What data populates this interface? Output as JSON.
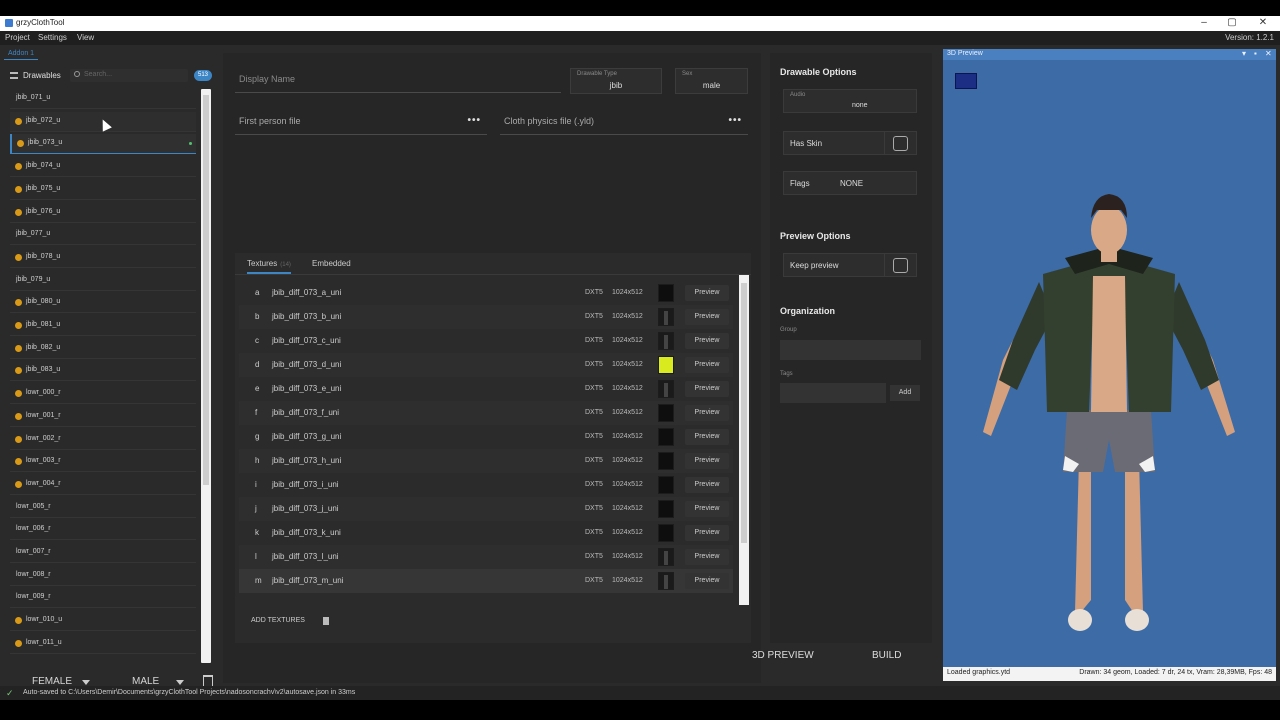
{
  "window": {
    "title": "grzyClothTool"
  },
  "menu": {
    "items": [
      "Project",
      "Settings",
      "View"
    ],
    "version": "Version: 1.2.1"
  },
  "addon_tab": "Addon 1",
  "left": {
    "header": "Drawables",
    "search_placeholder": "Search...",
    "count": "513",
    "items": [
      {
        "label": "jbib_071_u",
        "dot": false
      },
      {
        "label": "jbib_072_u",
        "dot": true
      },
      {
        "label": "jbib_073_u",
        "dot": true
      },
      {
        "label": "jbib_074_u",
        "dot": true
      },
      {
        "label": "jbib_075_u",
        "dot": true
      },
      {
        "label": "jbib_076_u",
        "dot": true
      },
      {
        "label": "jbib_077_u",
        "dot": false
      },
      {
        "label": "jbib_078_u",
        "dot": true
      },
      {
        "label": "jbib_079_u",
        "dot": false
      },
      {
        "label": "jbib_080_u",
        "dot": true
      },
      {
        "label": "jbib_081_u",
        "dot": true
      },
      {
        "label": "jbib_082_u",
        "dot": true
      },
      {
        "label": "jbib_083_u",
        "dot": true
      },
      {
        "label": "lowr_000_r",
        "dot": true
      },
      {
        "label": "lowr_001_r",
        "dot": true
      },
      {
        "label": "lowr_002_r",
        "dot": true
      },
      {
        "label": "lowr_003_r",
        "dot": true
      },
      {
        "label": "lowr_004_r",
        "dot": true
      },
      {
        "label": "lowr_005_r",
        "dot": false
      },
      {
        "label": "lowr_006_r",
        "dot": false
      },
      {
        "label": "lowr_007_r",
        "dot": false
      },
      {
        "label": "lowr_008_r",
        "dot": false
      },
      {
        "label": "lowr_009_r",
        "dot": false
      },
      {
        "label": "lowr_010_u",
        "dot": true
      },
      {
        "label": "lowr_011_u",
        "dot": true
      }
    ],
    "selected_label": "jbib_073_u",
    "hovered_label": "jbib_072_u",
    "female_label": "FEMALE",
    "male_label": "MALE"
  },
  "center": {
    "display_name_placeholder": "Display Name",
    "drawable_type": {
      "caption": "Drawable Type",
      "value": "jbib"
    },
    "sex": {
      "caption": "Sex",
      "value": "male"
    },
    "first_person_label": "First person file",
    "cloth_physics_label": "Cloth physics file (.yld)",
    "tabs": {
      "textures": "Textures",
      "textures_count": "(14)",
      "embedded": "Embedded"
    },
    "textures": [
      {
        "letter": "a",
        "name": "jbib_diff_073_a_uni",
        "format": "DXT5",
        "size": "1024x512",
        "thumb": "dark"
      },
      {
        "letter": "b",
        "name": "jbib_diff_073_b_uni",
        "format": "DXT5",
        "size": "1024x512",
        "thumb": "mid"
      },
      {
        "letter": "c",
        "name": "jbib_diff_073_c_uni",
        "format": "DXT5",
        "size": "1024x512",
        "thumb": "mid"
      },
      {
        "letter": "d",
        "name": "jbib_diff_073_d_uni",
        "format": "DXT5",
        "size": "1024x512",
        "thumb": "yellow"
      },
      {
        "letter": "e",
        "name": "jbib_diff_073_e_uni",
        "format": "DXT5",
        "size": "1024x512",
        "thumb": "mid"
      },
      {
        "letter": "f",
        "name": "jbib_diff_073_f_uni",
        "format": "DXT5",
        "size": "1024x512",
        "thumb": "dark"
      },
      {
        "letter": "g",
        "name": "jbib_diff_073_g_uni",
        "format": "DXT5",
        "size": "1024x512",
        "thumb": "dark"
      },
      {
        "letter": "h",
        "name": "jbib_diff_073_h_uni",
        "format": "DXT5",
        "size": "1024x512",
        "thumb": "dark"
      },
      {
        "letter": "i",
        "name": "jbib_diff_073_i_uni",
        "format": "DXT5",
        "size": "1024x512",
        "thumb": "dark"
      },
      {
        "letter": "j",
        "name": "jbib_diff_073_j_uni",
        "format": "DXT5",
        "size": "1024x512",
        "thumb": "dark"
      },
      {
        "letter": "k",
        "name": "jbib_diff_073_k_uni",
        "format": "DXT5",
        "size": "1024x512",
        "thumb": "dark"
      },
      {
        "letter": "l",
        "name": "jbib_diff_073_l_uni",
        "format": "DXT5",
        "size": "1024x512",
        "thumb": "mid"
      },
      {
        "letter": "m",
        "name": "jbib_diff_073_m_uni",
        "format": "DXT5",
        "size": "1024x512",
        "thumb": "mid"
      }
    ],
    "preview_button_label": "Preview",
    "add_textures_label": "ADD TEXTURES"
  },
  "right": {
    "drawable_options": "Drawable Options",
    "audio": {
      "caption": "Audio",
      "value": "none"
    },
    "has_skin_label": "Has Skin",
    "flags": {
      "label": "Flags",
      "value": "NONE"
    },
    "preview_options": "Preview Options",
    "keep_preview_label": "Keep preview",
    "organization": "Organization",
    "group_label": "Group",
    "tags_label": "Tags",
    "add_label": "Add"
  },
  "bottom": {
    "preview_3d": "3D PREVIEW",
    "build": "BUILD"
  },
  "preview": {
    "title": "3D Preview",
    "status_left": "Loaded graphics.ytd",
    "status_right": "Drawn: 34 geom, Loaded: 7 dr, 24 tx, Vram: 28,39MB, Fps: 48"
  },
  "statusbar": {
    "message": "Auto-saved to C:\\Users\\Demir\\Documents\\grzyClothTool Projects\\nadosoncrachv\\v2\\autosave.json in 33ms"
  },
  "colors": {
    "accent": "#3d86c6",
    "warning_dot": "#d99a17",
    "viewport_bg": "#3c6ba6"
  }
}
